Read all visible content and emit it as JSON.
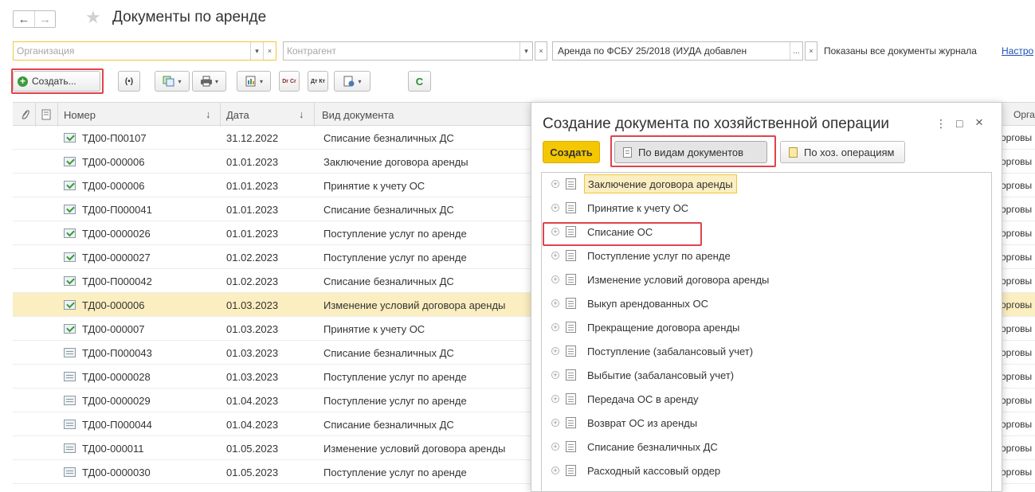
{
  "window": {
    "title": "Документы по аренде",
    "nav": {
      "back": "←",
      "forward": "→",
      "favorite": "★"
    }
  },
  "filters": {
    "organization_placeholder": "Организация",
    "counterparty_placeholder": "Контрагент",
    "document_types_value": "Аренда по ФСБУ 25/2018 (ИУДА  добавлен",
    "dropdown_glyph": "▾",
    "clear_glyph": "×",
    "more_glyph": "...",
    "journal_note": "Показаны все документы журнала",
    "settings_link": "Настро"
  },
  "toolbar": {
    "create_label": "Создать...",
    "create_icon": "+",
    "radio_label": "(•)",
    "dt_label": "Dr Cr",
    "dt2_label": "Дт Кт",
    "refresh_label": "C",
    "menu_arrow": "▾"
  },
  "table": {
    "columns": {
      "attach": "attachment-icon",
      "doc": "document-icon",
      "number": "Номер",
      "date": "Дата",
      "type": "Вид документа",
      "org": "Органи"
    },
    "sort_glyph": "↓",
    "org_cell": "орговы",
    "rows": [
      {
        "number": "ТД00-П00107",
        "date": "31.12.2022",
        "type": "Списание безналичных ДС",
        "posted": true
      },
      {
        "number": "ТД00-000006",
        "date": "01.01.2023",
        "type": "Заключение договора аренды",
        "posted": true
      },
      {
        "number": "ТД00-000006",
        "date": "01.01.2023",
        "type": "Принятие к учету ОС",
        "posted": true
      },
      {
        "number": "ТД00-П000041",
        "date": "01.01.2023",
        "type": "Списание безналичных ДС",
        "posted": true
      },
      {
        "number": "ТД00-0000026",
        "date": "01.01.2023",
        "type": "Поступление услуг по аренде",
        "posted": true
      },
      {
        "number": "ТД00-0000027",
        "date": "01.02.2023",
        "type": "Поступление услуг по аренде",
        "posted": true
      },
      {
        "number": "ТД00-П000042",
        "date": "01.02.2023",
        "type": "Списание безналичных ДС",
        "posted": true
      },
      {
        "number": "ТД00-000006",
        "date": "01.03.2023",
        "type": "Изменение условий договора аренды",
        "posted": true,
        "selected": true
      },
      {
        "number": "ТД00-000007",
        "date": "01.03.2023",
        "type": "Принятие к учету ОС",
        "posted": true
      },
      {
        "number": "ТД00-П000043",
        "date": "01.03.2023",
        "type": "Списание безналичных ДС",
        "posted": false
      },
      {
        "number": "ТД00-0000028",
        "date": "01.03.2023",
        "type": "Поступление услуг по аренде",
        "posted": false
      },
      {
        "number": "ТД00-0000029",
        "date": "01.04.2023",
        "type": "Поступление услуг по аренде",
        "posted": false
      },
      {
        "number": "ТД00-П000044",
        "date": "01.04.2023",
        "type": "Списание безналичных ДС",
        "posted": false
      },
      {
        "number": "ТД00-000011",
        "date": "01.05.2023",
        "type": "Изменение условий договора аренды",
        "posted": false
      },
      {
        "number": "ТД00-0000030",
        "date": "01.05.2023",
        "type": "Поступление услуг по аренде",
        "posted": false
      }
    ]
  },
  "popup": {
    "title": "Создание документа по хозяйственной операции",
    "menu_glyph": "⋮",
    "maximize_glyph": "□",
    "close_glyph": "×",
    "create_label": "Создать",
    "by_types_label": "По видам документов",
    "by_operations_label": "По хоз. операциям",
    "expand_glyph": "+",
    "items": [
      "Заключение договора аренды",
      "Принятие к учету ОС",
      "Списание ОС",
      "Поступление услуг по аренде",
      "Изменение условий договора аренды",
      "Выкуп арендованных ОС",
      "Прекращение договора аренды",
      "Поступление (забалансовый учет)",
      "Выбытие (забалансовый учет)",
      "Передача ОС в аренду",
      "Возврат ОС из аренды",
      "Списание безналичных ДС",
      "Расходный кассовый ордер"
    ]
  },
  "colors": {
    "accent_yellow": "#f5c700",
    "selection": "#fbeec0",
    "highlight_frame": "#e0434b",
    "link": "#1a4fb5"
  }
}
